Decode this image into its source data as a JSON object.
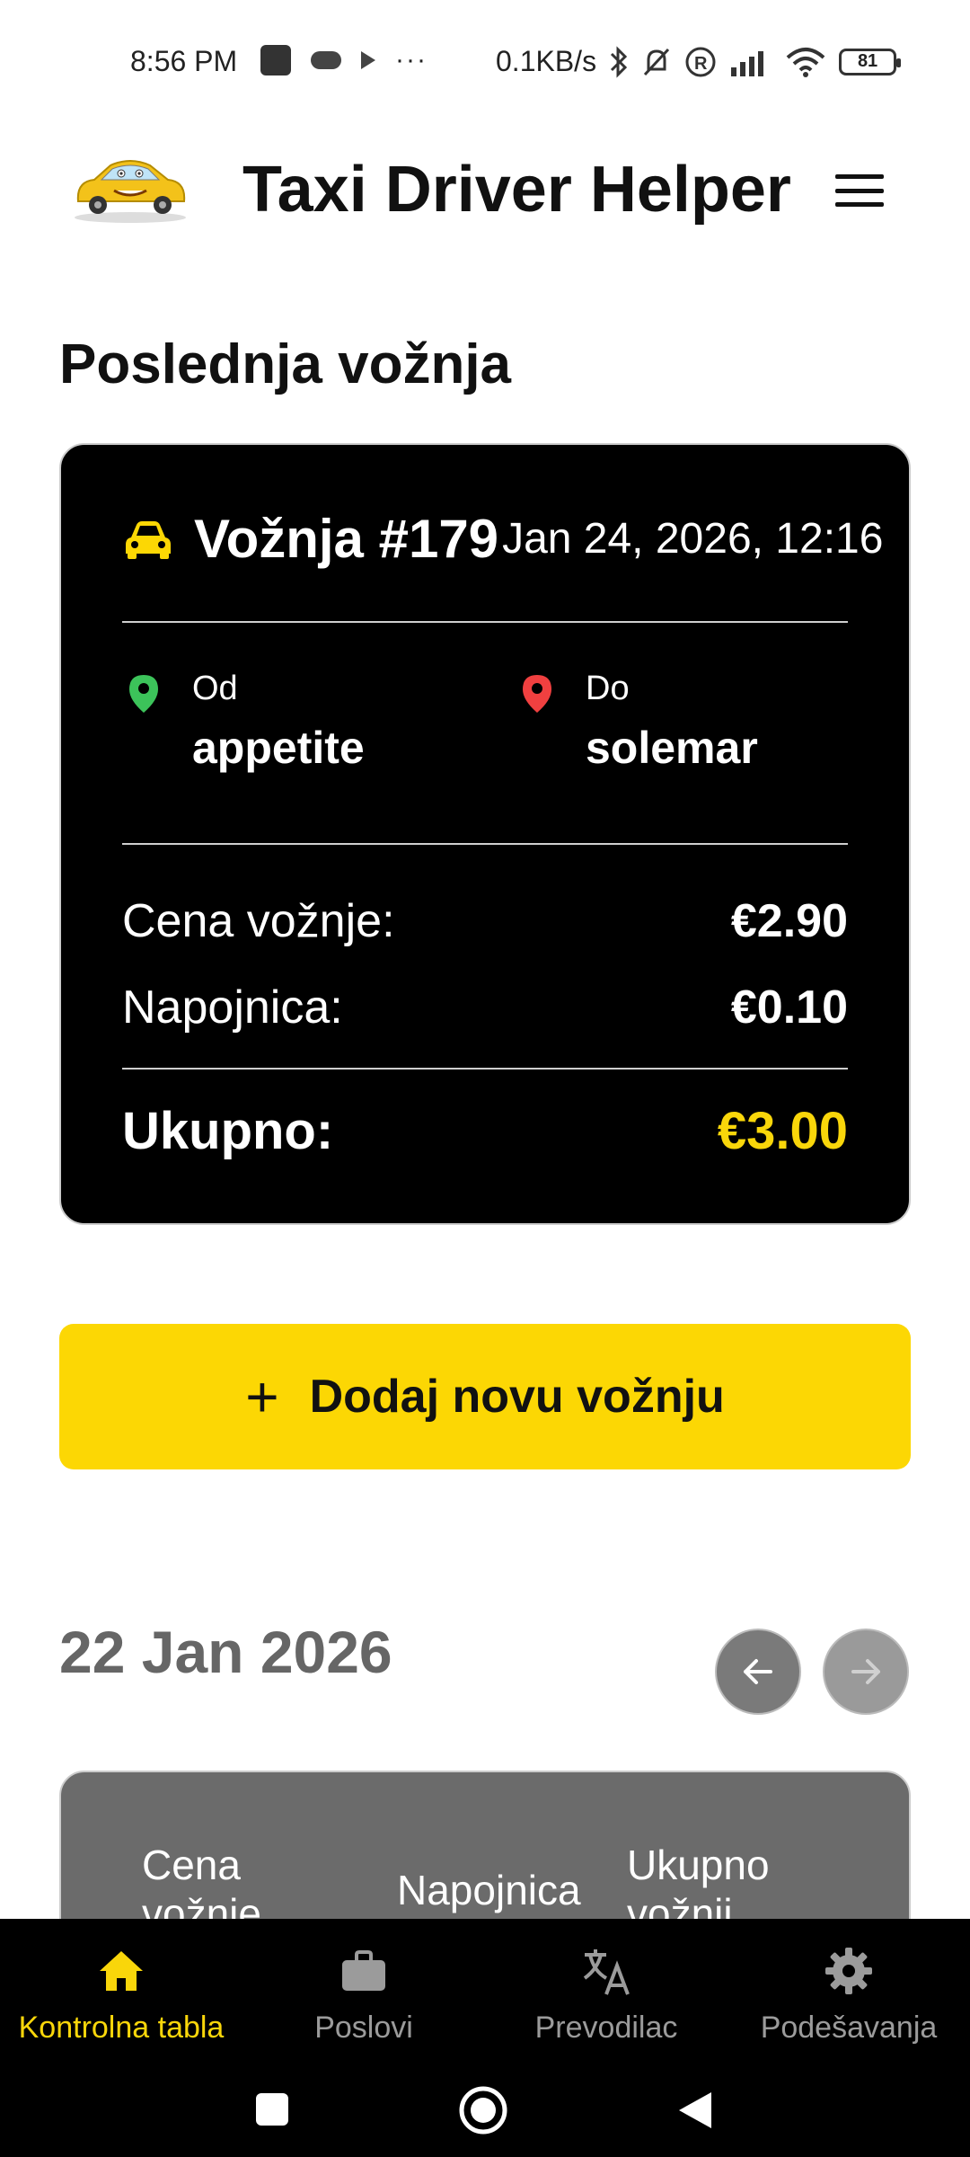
{
  "status_bar": {
    "time": "8:56 PM",
    "dots": "···",
    "net_speed": "0.1KB/s",
    "battery": "81"
  },
  "header": {
    "title": "Taxi Driver Helper"
  },
  "last_ride": {
    "section_title": "Poslednja vožnja",
    "ride_number": "Vožnja #179",
    "date": "Jan 24, 2026, 12:16",
    "from_label": "Od",
    "from_value": "appetite",
    "to_label": "Do",
    "to_value": "solemar",
    "fare_label": "Cena vožnje:",
    "fare_value": "€2.90",
    "tip_label": "Napojnica:",
    "tip_value": "€0.10",
    "total_label": "Ukupno:",
    "total_value": "€3.00"
  },
  "add_button": {
    "plus": "+",
    "label": "Dodaj novu vožnju"
  },
  "daily": {
    "date": "22 Jan 2026",
    "col_fare": "Cena vožnje",
    "col_tip": "Napojnica",
    "col_total": "Ukupno vožnji"
  },
  "bottom_nav": {
    "items": [
      {
        "label": "Kontrolna tabla",
        "icon": "home-icon",
        "active": true
      },
      {
        "label": "Poslovi",
        "icon": "briefcase-icon",
        "active": false
      },
      {
        "label": "Prevodilac",
        "icon": "translate-icon",
        "active": false
      },
      {
        "label": "Podešavanja",
        "icon": "gear-icon",
        "active": false
      }
    ]
  },
  "colors": {
    "accent": "#fcd704",
    "card": "#000000",
    "pin_from": "#3cc35a",
    "pin_to": "#f04040"
  }
}
